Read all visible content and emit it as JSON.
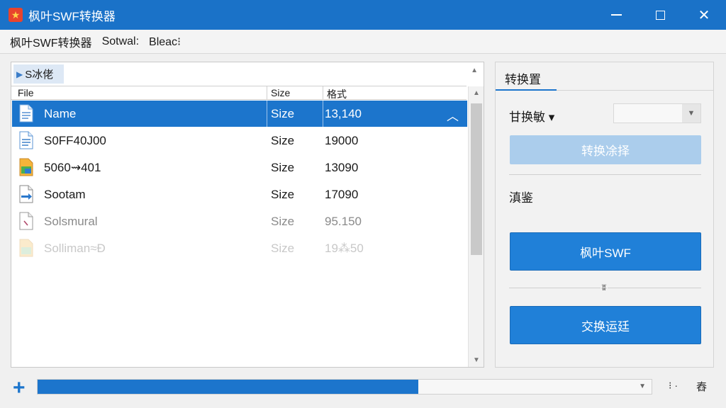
{
  "window": {
    "title": "枫叶SWF转换器",
    "app_icon": "star-icon",
    "accent_color": "#1a72c8"
  },
  "menubar": {
    "items": [
      "枫叶SWF转换器",
      "Sotwal:",
      "Bleac⁝"
    ]
  },
  "file_panel": {
    "path_label": "S冰佬",
    "columns": [
      "File",
      "Size",
      "格式"
    ],
    "rows": [
      {
        "name": "Name",
        "size": "Size",
        "value": "13,140",
        "icon": "document-icon",
        "selected": true
      },
      {
        "name": "S0FF40J00",
        "size": "Size",
        "value": "19000",
        "icon": "document-icon"
      },
      {
        "name": "5060⇝401",
        "size": "Size",
        "value": "13090",
        "icon": "image-file-icon"
      },
      {
        "name": "Sootam",
        "size": "Size",
        "value": "17090",
        "icon": "arrow-file-icon"
      },
      {
        "name": "Solsmural",
        "size": "Size",
        "value": "95.150",
        "icon": "pen-file-icon"
      },
      {
        "name": "Solliman≈Ɖ",
        "size": "Size",
        "value": "19⁂50",
        "icon": "image-file-icon"
      }
    ]
  },
  "right_panel": {
    "tab_label": "转换置",
    "mode_label": "甘换敏 ▾",
    "select_value": "",
    "primary_disabled_button": "转换凃择",
    "preview_label": "滇鉴",
    "swf_button": "枫叶SWF",
    "divider_mark": "ʬ",
    "run_button": "交换运廷"
  },
  "bottombar": {
    "progress_percent": 62,
    "dots": "⁝ ·",
    "settings": "舂"
  }
}
